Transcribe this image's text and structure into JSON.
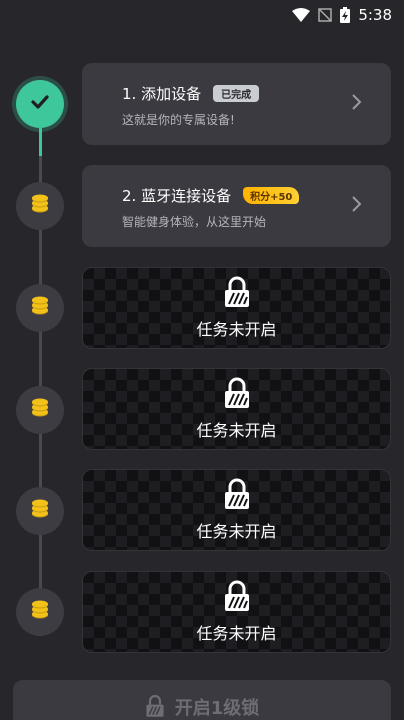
{
  "status_bar": {
    "time": "5:38"
  },
  "tasks": [
    {
      "title": "1. 添加设备",
      "subtitle": "这就是你的专属设备!",
      "badge": "已完成",
      "state": "done"
    },
    {
      "title": "2. 蓝牙连接设备",
      "subtitle": "智能健身体验，从这里开始",
      "badge": "积分+50",
      "state": "available"
    }
  ],
  "locked_label": "任务未开启",
  "locked_cards": [
    {
      "label": "任务未开启"
    },
    {
      "label": "任务未开启"
    },
    {
      "label": "任务未开启"
    },
    {
      "label": "任务未开启"
    }
  ],
  "bottom_button": {
    "label": "开启1级锁",
    "icon": "lock-icon",
    "enabled": false
  },
  "colors": {
    "background": "#26262b",
    "card": "#3a3a40",
    "success": "#3ec79a",
    "coin": "#f2c21b",
    "points_badge": "#ffb300",
    "done_badge": "#c9cdd3"
  }
}
